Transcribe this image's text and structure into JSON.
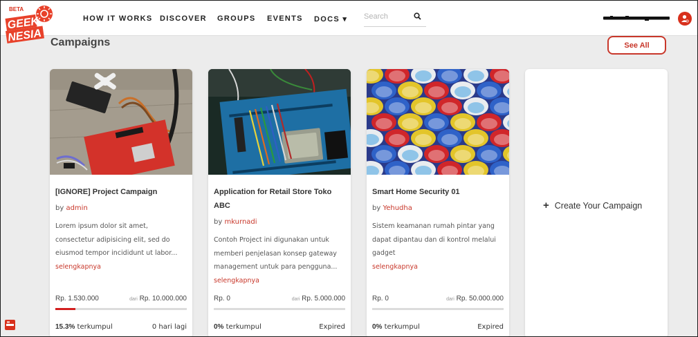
{
  "brand": {
    "beta": "BETA",
    "line1": "GEEK",
    "line2": "NESIA"
  },
  "nav": {
    "links": [
      "HOW IT WORKS",
      "DISCOVER",
      "GROUPS",
      "EVENTS",
      "DOCS"
    ],
    "docs_caret": "▾"
  },
  "search": {
    "placeholder": "Search",
    "icon": "search-icon"
  },
  "user": {
    "avatar_icon": "user-icon"
  },
  "header": {
    "title": "Campaigns",
    "see_all": "See All"
  },
  "campaigns": [
    {
      "title": "[IGNORE] Project Campaign",
      "by": "by",
      "author": "admin",
      "description": "Lorem ipsum dolor sit amet, consectetur adipisicing elit, sed do eiusmod tempor incididunt ut labor...",
      "read_more": "selengkapnya",
      "raised": "Rp.  1.530.000",
      "of": "dari",
      "target": "Rp. 10.000.000",
      "progress": 0.153,
      "percent": "15.3%",
      "collected_label": "terkumpul",
      "status": "0 hari lagi"
    },
    {
      "title": "Application for Retail Store Toko ABC",
      "by": "by",
      "author": "mkurnadi",
      "description": "Contoh Project ini digunakan untuk memberi penjelasan konsep gateway management untuk para pengguna...",
      "read_more": "selengkapnya",
      "raised": "Rp.  0",
      "of": "dari",
      "target": "Rp. 5.000.000",
      "progress": 0,
      "percent": "0%",
      "collected_label": "terkumpul",
      "status": "Expired"
    },
    {
      "title": "Smart Home Security 01",
      "by": "by",
      "author": "Yehudha",
      "description": "Sistem keamanan rumah pintar yang dapat dipantau dan di kontrol melalui gadget",
      "read_more": "selengkapnya",
      "raised": "Rp.  0",
      "of": "dari",
      "target": "Rp. 50.000.000",
      "progress": 0,
      "percent": "0%",
      "collected_label": "terkumpul",
      "status": "Expired"
    }
  ],
  "create": {
    "icon": "plus-icon",
    "label": "Create Your Campaign"
  },
  "colors": {
    "accent": "#c8372a",
    "progress": "#d21f1f",
    "background": "#ececec"
  }
}
